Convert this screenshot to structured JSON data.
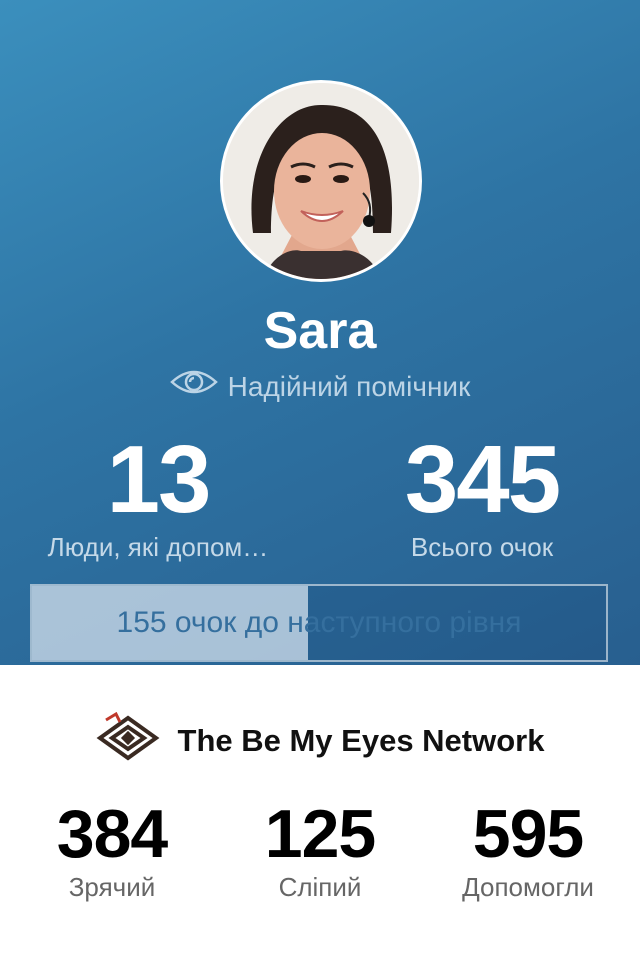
{
  "profile": {
    "name": "Sara",
    "role_label": "Надійний помічник",
    "role_icon": "eye-icon",
    "stats": [
      {
        "value": "13",
        "label": "Люди, які допом…"
      },
      {
        "value": "345",
        "label": "Всього очок"
      }
    ],
    "progress": {
      "text": "155 очок до наступного рівня",
      "fraction": 0.48
    }
  },
  "network": {
    "title": "The Be My Eyes Network",
    "logo_icon": "be-my-eyes-logo-icon",
    "stats": [
      {
        "value": "384",
        "label": "Зрячий"
      },
      {
        "value": "125",
        "label": "Сліпий"
      },
      {
        "value": "595",
        "label": "Допомогли"
      }
    ]
  },
  "colors": {
    "header_top": "#3b8fbd",
    "header_bottom": "#285f8f",
    "progress_text": "#356f9e"
  }
}
